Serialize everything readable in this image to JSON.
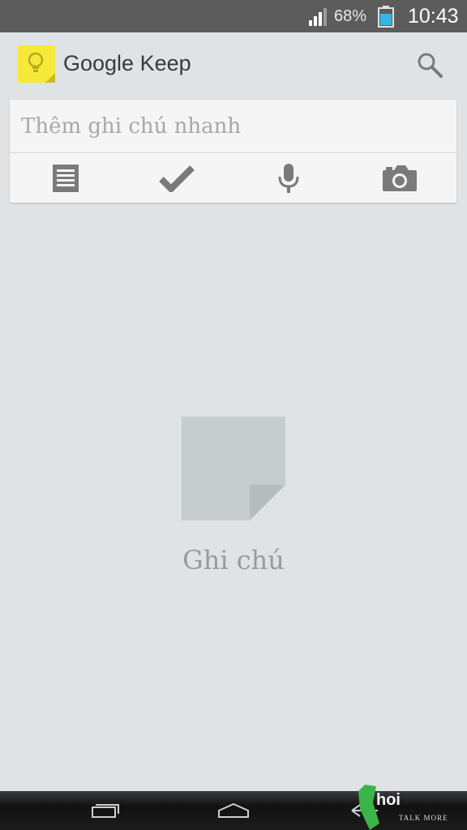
{
  "status_bar": {
    "battery_percent": "68%",
    "time": "10:43"
  },
  "action_bar": {
    "title": "Google Keep"
  },
  "quick_note": {
    "placeholder": "Thêm ghi chú nhanh",
    "tools": [
      "text-note-icon",
      "checklist-icon",
      "microphone-icon",
      "camera-icon"
    ]
  },
  "empty_state": {
    "label": "Ghi chú"
  },
  "watermark": {
    "brand": "hoi",
    "tagline": "TALK MORE"
  },
  "colors": {
    "background": "#dfe3e6",
    "card": "#f5f5f5",
    "icon_gray": "#777777",
    "logo_yellow": "#f6e93a"
  }
}
